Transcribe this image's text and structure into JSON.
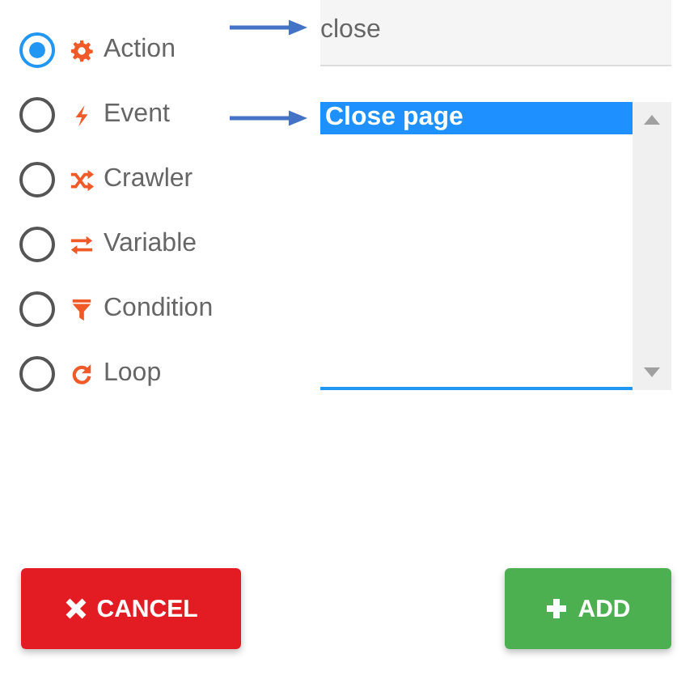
{
  "types": [
    {
      "label": "Action",
      "kind": "gear",
      "selected": true
    },
    {
      "label": "Event",
      "kind": "bolt",
      "selected": false
    },
    {
      "label": "Crawler",
      "kind": "shuffle",
      "selected": false
    },
    {
      "label": "Variable",
      "kind": "swap",
      "selected": false
    },
    {
      "label": "Condition",
      "kind": "filter",
      "selected": false
    },
    {
      "label": "Loop",
      "kind": "refresh",
      "selected": false
    }
  ],
  "search": {
    "value": "close"
  },
  "results": [
    {
      "label": "Close page",
      "selected": true
    }
  ],
  "buttons": [
    {
      "label": "CANCEL",
      "kind": "cancel"
    },
    {
      "label": "ADD",
      "kind": "add"
    }
  ]
}
